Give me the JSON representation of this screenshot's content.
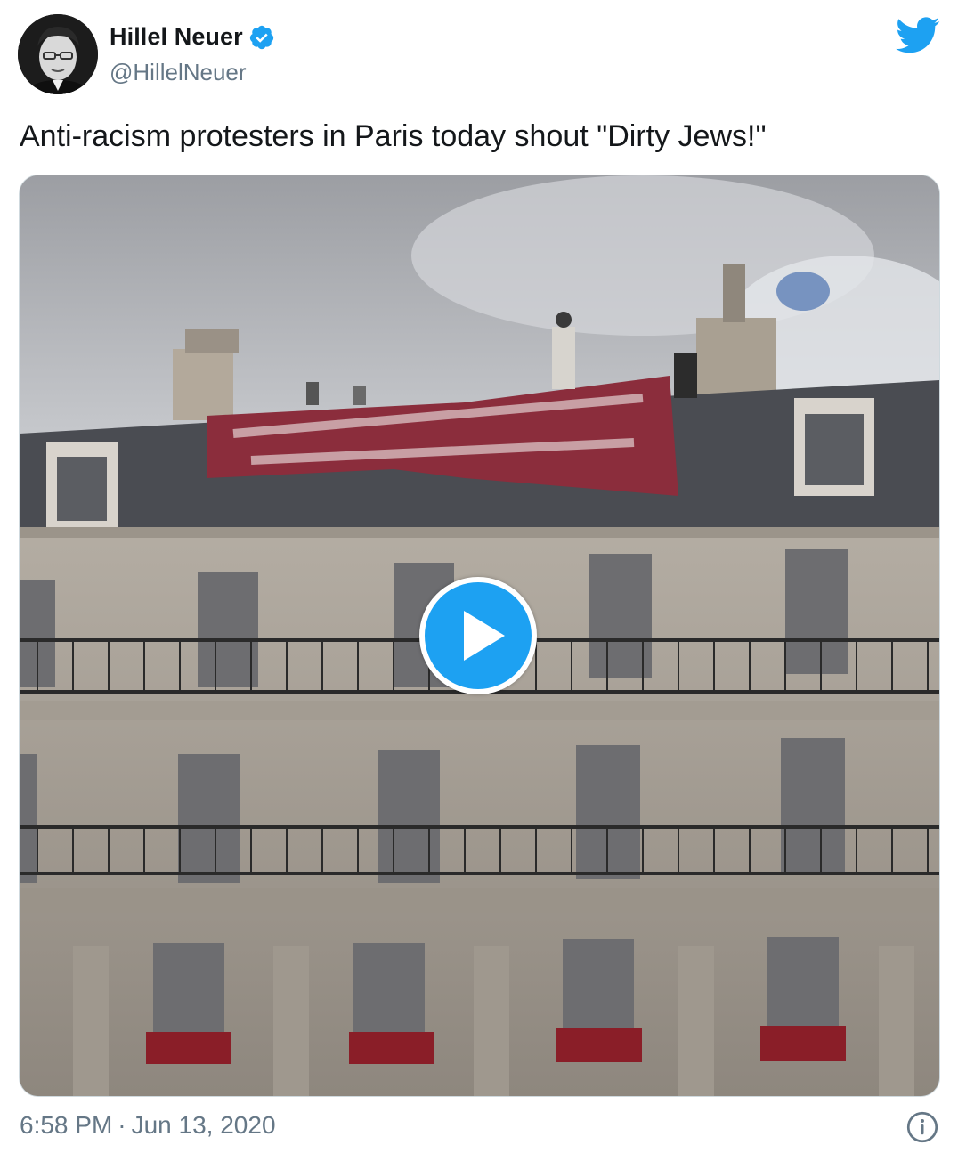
{
  "author": {
    "display_name": "Hillel Neuer",
    "handle": "@HillelNeuer",
    "verified": true
  },
  "tweet": {
    "text": "Anti-racism protesters in Paris today shout \"Dirty Jews!\"",
    "time": "6:58 PM",
    "separator": "·",
    "date": "Jun 13, 2020"
  },
  "media": {
    "type": "video",
    "play_icon": "play-icon",
    "banner_color": "#8b2d3c"
  },
  "icons": {
    "brand": "twitter-bird-icon",
    "verified": "verified-badge-icon",
    "info": "info-icon"
  },
  "colors": {
    "accent": "#1da1f2",
    "text": "#14171a",
    "secondary_text": "#657786",
    "border": "#cfd9de"
  }
}
